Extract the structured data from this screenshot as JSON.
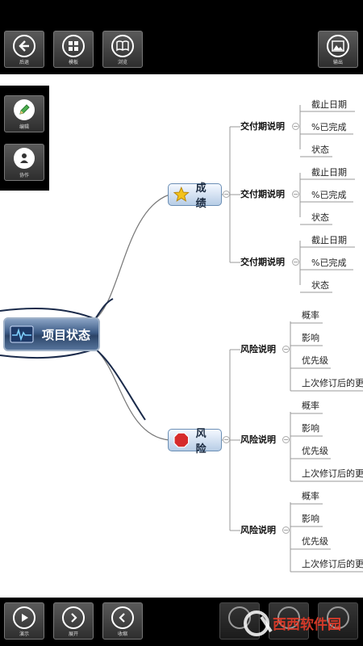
{
  "toolbar": {
    "back_label": "后退",
    "template_label": "模板",
    "browse_label": "浏览",
    "export_label": "输出"
  },
  "side": {
    "edit_label": "编辑",
    "collaborate_label": "协作"
  },
  "bottombar": {
    "present_label": "演示",
    "expand_label": "展开",
    "collapse_label": "收缩"
  },
  "map": {
    "root": "项目状态",
    "branches": [
      {
        "label": "成绩",
        "icon": "star-icon",
        "subtopics": [
          {
            "label": "交付期说明",
            "items": [
              "截止日期",
              "%已完成",
              "状态"
            ]
          },
          {
            "label": "交付期说明",
            "items": [
              "截止日期",
              "%已完成",
              "状态"
            ]
          },
          {
            "label": "交付期说明",
            "items": [
              "截止日期",
              "%已完成",
              "状态"
            ]
          }
        ]
      },
      {
        "label": "风险",
        "icon": "stop-icon",
        "subtopics": [
          {
            "label": "风险说明",
            "items": [
              "概率",
              "影响",
              "优先级",
              "上次修订后的更"
            ]
          },
          {
            "label": "风险说明",
            "items": [
              "概率",
              "影响",
              "优先级",
              "上次修订后的更"
            ]
          },
          {
            "label": "风险说明",
            "items": [
              "概率",
              "影响",
              "优先级",
              "上次修订后的更"
            ]
          }
        ]
      }
    ]
  },
  "watermark": "西西软件园",
  "colors": {
    "topbar": "#000000",
    "canvas": "#ffffff",
    "root_fill": "#3c5b86",
    "topic_fill": "#b7cde6",
    "stop": "#d62b2b",
    "star": "#f3c21b"
  }
}
